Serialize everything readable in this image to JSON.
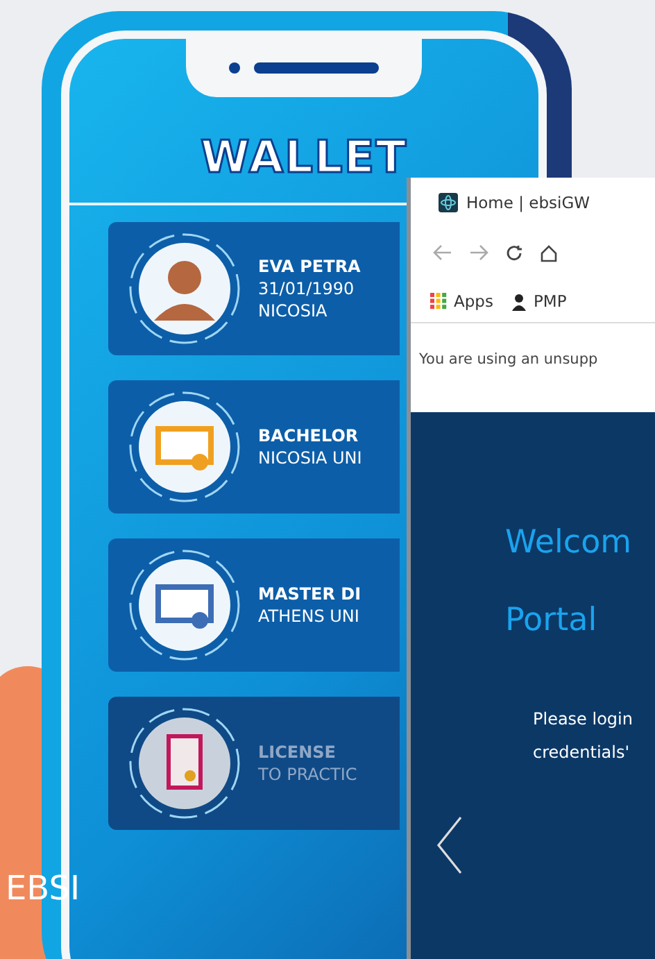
{
  "wallet": {
    "title": "WALLET",
    "cards": [
      {
        "kind": "person",
        "disabled": false,
        "color": "#b5673f",
        "lines": [
          "EVA PETRA",
          "31/01/1990",
          "NICOSIA"
        ]
      },
      {
        "kind": "diploma",
        "disabled": false,
        "color": "#f0a020",
        "lines": [
          "BACHELOR",
          "NICOSIA UNI"
        ]
      },
      {
        "kind": "diploma",
        "disabled": false,
        "color": "#3d6db5",
        "lines": [
          "MASTER DI",
          "ATHENS UNI"
        ]
      },
      {
        "kind": "license",
        "disabled": true,
        "color": "#c2185b",
        "lines": [
          "LICENSE",
          "TO PRACTIC"
        ]
      }
    ]
  },
  "browser": {
    "tab_title": "Home | ebsiGW",
    "bookmarks": [
      "Apps",
      "PMP"
    ],
    "warning": "You are using an unsupp",
    "heading": [
      "Welcom",
      "Portal"
    ],
    "body": [
      "Please login",
      "credentials'"
    ]
  },
  "caption": "EBSI"
}
